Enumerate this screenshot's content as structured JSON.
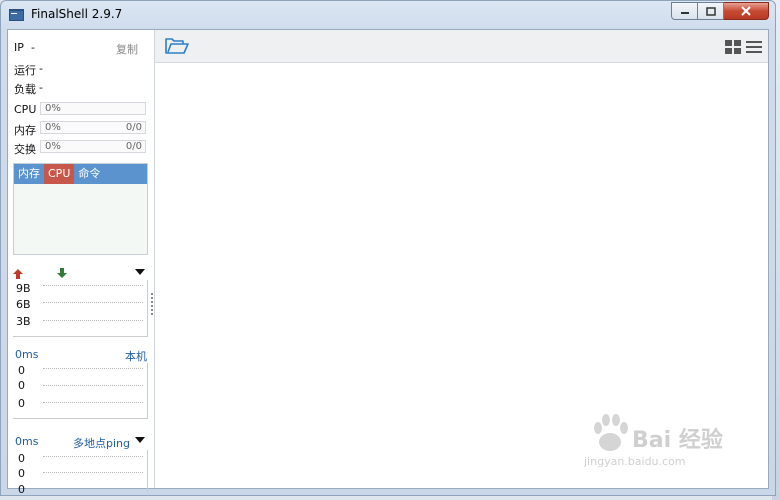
{
  "window": {
    "title": "FinalShell 2.9.7"
  },
  "sidebar": {
    "ip_label": "IP",
    "ip_value": "-",
    "copy_label": "复制",
    "uptime_label": "运行",
    "uptime_value": "-",
    "load_label": "负载",
    "load_value": "-",
    "cpu": {
      "label": "CPU",
      "percent": "0%"
    },
    "memory": {
      "label": "内存",
      "percent": "0%",
      "value": "0/0"
    },
    "swap": {
      "label": "交换",
      "percent": "0%",
      "value": "0/0"
    },
    "process_tabs": [
      {
        "label": "内存",
        "active": false
      },
      {
        "label": "CPU",
        "active": true
      },
      {
        "label": "命令",
        "active": false
      }
    ],
    "network": {
      "ticks": [
        "9B",
        "6B",
        "3B"
      ]
    },
    "latency": {
      "value": "0ms",
      "target": "本机",
      "ticks": [
        "0",
        "0",
        "0"
      ]
    },
    "ping": {
      "value": "0ms",
      "target": "多地点ping",
      "ticks": [
        "0",
        "0",
        "0"
      ]
    }
  },
  "watermark": {
    "text": "Bai 经验",
    "url": "jingyan.baidu.com"
  },
  "colors": {
    "tab_bar": "#5b93cf",
    "tab_active": "#c8574b",
    "upload_arrow": "#c0392b",
    "download_arrow": "#2e7d32",
    "link": "#1f5da3"
  },
  "icons": [
    "app-icon",
    "minimize-icon",
    "maximize-icon",
    "close-icon",
    "folder-open-icon",
    "grid-view-icon",
    "menu-icon",
    "upload-arrow-icon",
    "download-arrow-icon",
    "dropdown-icon"
  ]
}
